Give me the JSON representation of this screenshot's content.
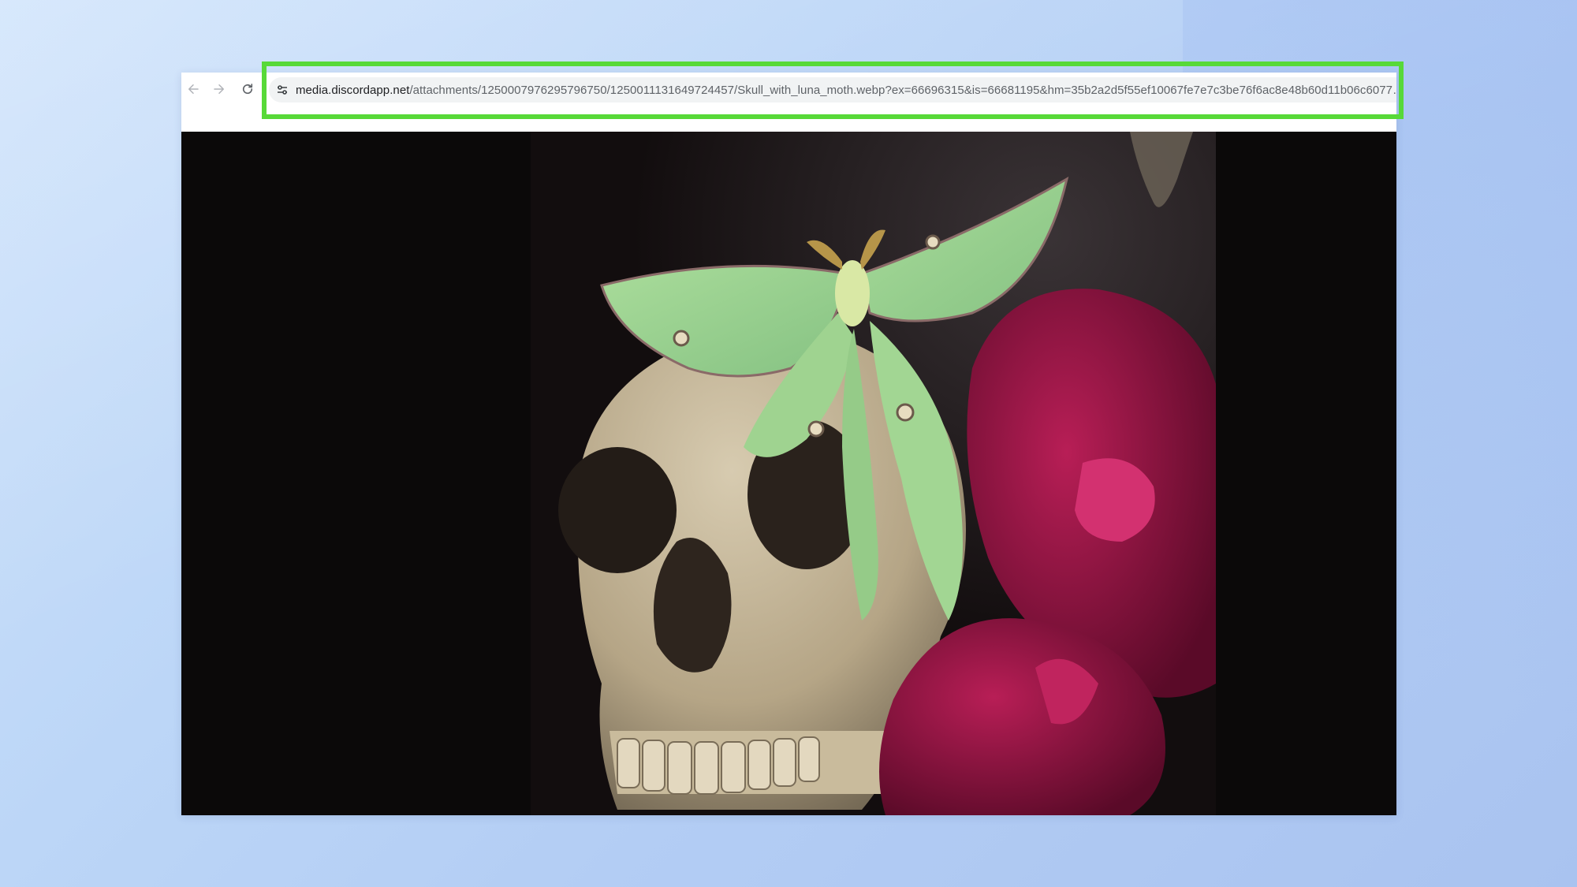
{
  "browser": {
    "nav": {
      "back_icon": "arrow-left-icon",
      "forward_icon": "arrow-right-icon",
      "reload_icon": "reload-icon"
    },
    "address_bar": {
      "site_info_icon": "tune-icon",
      "host": "media.discordapp.net",
      "path": "/attachments/1250007976295796750/1250011131649724457/Skull_with_luna_moth.webp?ex=66696315&is=66681195&hm=35b2a2d5f55ef10067fe7e7c3be76f6ac8e48b60d11b06c6077…"
    }
  },
  "highlight": {
    "color": "#57d938"
  },
  "content": {
    "image_subject": "skull-with-luna-moth-photo"
  },
  "colors": {
    "viewer_background": "#0b0909",
    "highlight_border": "#57d938"
  }
}
